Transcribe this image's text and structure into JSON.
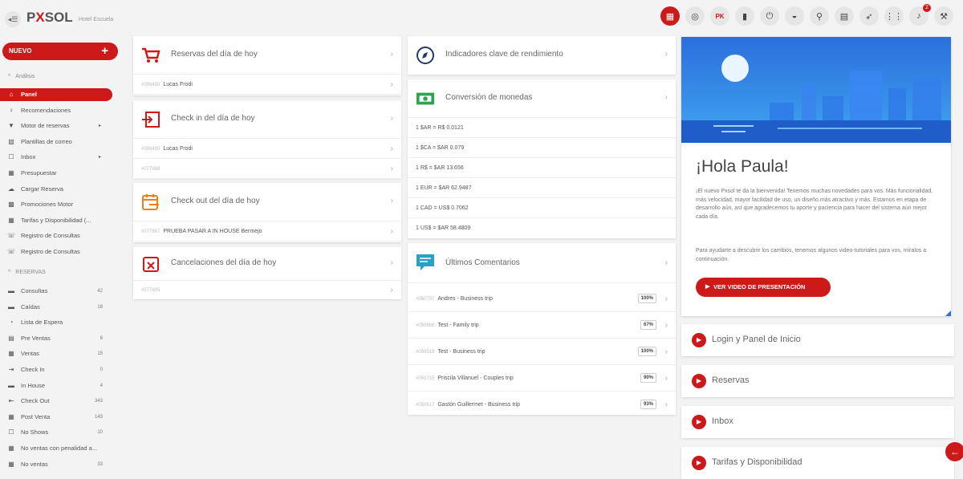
{
  "header": {
    "back_label": "◂☰",
    "logo_pre": "P",
    "logo_x": "X",
    "logo_post": "SOL",
    "hotel_name": "Hotel Escuela",
    "icons": [
      {
        "name": "calendar-icon",
        "glyph": "▦",
        "style": "red"
      },
      {
        "name": "support-icon",
        "glyph": "◎",
        "style": ""
      },
      {
        "name": "pk-icon",
        "glyph": "PK",
        "style": "pink"
      },
      {
        "name": "book-icon",
        "glyph": "▮",
        "style": ""
      },
      {
        "name": "power-icon",
        "glyph": "⏻",
        "style": ""
      },
      {
        "name": "globe-icon",
        "glyph": "◒",
        "style": ""
      },
      {
        "name": "search-icon",
        "glyph": "⚲",
        "style": ""
      },
      {
        "name": "document-icon",
        "glyph": "▤",
        "style": ""
      },
      {
        "name": "rocket-icon",
        "glyph": "➶",
        "style": ""
      },
      {
        "name": "grid-icon",
        "glyph": "⋮⋮",
        "style": ""
      },
      {
        "name": "bell-icon",
        "glyph": "♪",
        "style": "",
        "badge": "2"
      },
      {
        "name": "wrench-icon",
        "glyph": "⚒",
        "style": ""
      }
    ]
  },
  "sidebar": {
    "new_button": "NUEVO",
    "section_analisis": "Análisis",
    "section_reservas": "RESERVAS",
    "analisis_items": [
      {
        "label": "Panel",
        "glyph": "⌂",
        "active": true,
        "arrow": ""
      },
      {
        "label": "Recomendaciones",
        "glyph": "♀",
        "active": false,
        "arrow": ""
      },
      {
        "label": "Motor de reservas",
        "glyph": "▼",
        "active": false,
        "arrow": "▸"
      },
      {
        "label": "Plantillas de correo",
        "glyph": "▧",
        "active": false,
        "arrow": ""
      },
      {
        "label": "Inbox",
        "glyph": "☐",
        "active": false,
        "arrow": "▸"
      },
      {
        "label": "Presupuestar",
        "glyph": "▦",
        "active": false,
        "arrow": ""
      },
      {
        "label": "Cargar Reserva",
        "glyph": "☁",
        "active": false,
        "arrow": ""
      },
      {
        "label": "Promociones Motor",
        "glyph": "▩",
        "active": false,
        "arrow": ""
      },
      {
        "label": "Tarifas y Disponibilidad (...",
        "glyph": "▦",
        "active": false,
        "arrow": ""
      },
      {
        "label": "Registro de Consultas",
        "glyph": "☏",
        "active": false,
        "arrow": ""
      },
      {
        "label": "Registro de Consultas",
        "glyph": "☏",
        "active": false,
        "arrow": ""
      }
    ],
    "reservas_items": [
      {
        "label": "Consultas",
        "glyph": "▬",
        "count": "42"
      },
      {
        "label": "Caídas",
        "glyph": "▬",
        "count": "18"
      },
      {
        "label": "Lista de Espera",
        "glyph": "◔",
        "count": ""
      },
      {
        "label": "Pre Ventas",
        "glyph": "▤",
        "count": "6"
      },
      {
        "label": "Ventas",
        "glyph": "▦",
        "count": "15"
      },
      {
        "label": "Check In",
        "glyph": "⇥",
        "count": "0"
      },
      {
        "label": "In House",
        "glyph": "▬",
        "count": "4"
      },
      {
        "label": "Check Out",
        "glyph": "⇤",
        "count": "343"
      },
      {
        "label": "Post Venta",
        "glyph": "▦",
        "count": "143"
      },
      {
        "label": "No Shows",
        "glyph": "☐",
        "count": "10"
      },
      {
        "label": "No ventas con penalidad a...",
        "glyph": "▦",
        "count": ""
      },
      {
        "label": "No ventas",
        "glyph": "▦",
        "count": "33"
      }
    ]
  },
  "col1": {
    "reservas": {
      "title": "Reservas del día de hoy",
      "rows": [
        {
          "muted": "#056495",
          "text": "Lucas Frodi"
        }
      ]
    },
    "checkin": {
      "title": "Check in del día de hoy",
      "rows": [
        {
          "muted": "#056495",
          "text": "Lucas Frodi"
        },
        {
          "muted": "#077868",
          "text": ""
        }
      ]
    },
    "checkout": {
      "title": "Check out del día de hoy",
      "rows": [
        {
          "muted": "#077667",
          "text": "PRUEBA PASAR A IN HOUSE Bermejo"
        }
      ]
    },
    "cancel": {
      "title": "Cancelaciones del día de hoy",
      "rows": [
        {
          "muted": "#077605",
          "text": ""
        }
      ]
    }
  },
  "col2": {
    "kpi": {
      "title": "Indicadores clave de rendimiento"
    },
    "currency": {
      "title": "Conversión de monedas",
      "rows": [
        "1 $AR = R$ 0.0121",
        "1 $CA = $AR 0.079",
        "1 R$ = $AR 13.656",
        "1 EUR = $AR 62.9487",
        "1 CAD = US$ 0.7062",
        "1 US$ = $AR 58.4809"
      ]
    },
    "comments": {
      "title": "Últimos Comentarios",
      "rows": [
        {
          "muted": "#050797",
          "text": "Andres - Business trip",
          "pct": "100%"
        },
        {
          "muted": "#050666",
          "text": "Test - Family trip",
          "pct": "67%"
        },
        {
          "muted": "#050519",
          "text": "Test - Business trip",
          "pct": "100%"
        },
        {
          "muted": "#050715",
          "text": "Priscila Villanuel - Couples trip",
          "pct": "90%"
        },
        {
          "muted": "#050617",
          "text": "Gastón Guillermet - Business trip",
          "pct": "93%"
        }
      ]
    }
  },
  "welcome": {
    "greeting": "¡Hola Paula!",
    "paragraph1": "¡El nuevo Pxsol te da la bienvenida! Tenemos muchas novedades para vos. Más funcionalidad, más velocidad, mayor facilidad de uso, un diseño más atractivo y más. Estamos en etapa de desarrollo aún, así que agradecemos tu aporte y paciencia para hacer del sistema aún mejor cada día.",
    "paragraph2": "Para ayudarte a descubrir los cambios, tenemos algunos video-tutoriales para vos, miralos a continuación.",
    "video_button": "VER VIDEO DE PRESENTACIÓN"
  },
  "tutorials": [
    "Login y Panel de Inicio",
    "Reservas",
    "Inbox",
    "Tarifas y Disponibilidad"
  ],
  "colors": {
    "brand_red": "#cc1a1a",
    "orange": "#f07f1a",
    "green": "#2ea44f",
    "teal": "#2aa0c8",
    "navy": "#223a66"
  }
}
